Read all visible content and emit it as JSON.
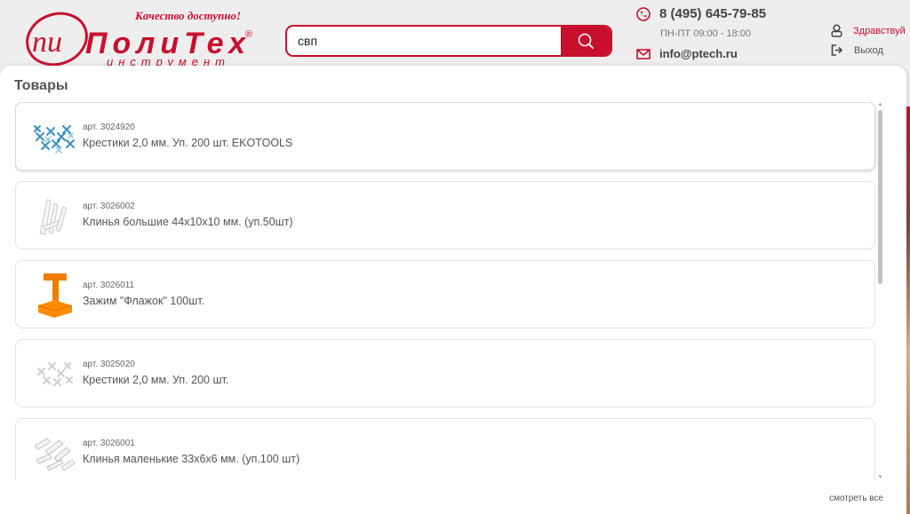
{
  "header": {
    "logo_text": "ПолиТех",
    "logo_sub": "инструмент",
    "slogan": "Качество доступно!",
    "phone": "8 (495) 645-79-85",
    "hours": "ПН-ПТ 09:00 - 18:00",
    "email": "info@ptech.ru",
    "greeting": "Здравствуй",
    "logout": "Выход",
    "brand_color": "#c8102e"
  },
  "search": {
    "value": "свп",
    "icon": "search-icon"
  },
  "results": {
    "title": "Товары",
    "see_all": "смотреть все",
    "items": [
      {
        "sku": "арт. 3024920",
        "name": "Крестики 2,0 мм. Уп. 200 шт. EKOTOOLS",
        "icon": "blue-crosses-icon"
      },
      {
        "sku": "арт. 3026002",
        "name": "Клинья большие 44х10х10 мм. (уп.50шт)",
        "icon": "white-wedges-icon"
      },
      {
        "sku": "арт. 3026011",
        "name": "Зажим \"Флажок\" 100шт.",
        "icon": "orange-clip-icon"
      },
      {
        "sku": "арт. 3025020",
        "name": "Крестики 2,0 мм. Уп. 200 шт.",
        "icon": "white-crosses-icon"
      },
      {
        "sku": "арт. 3026001",
        "name": "Клинья маленькие 33х6х6 мм. (уп.100 шт)",
        "icon": "small-wedges-icon"
      }
    ]
  }
}
